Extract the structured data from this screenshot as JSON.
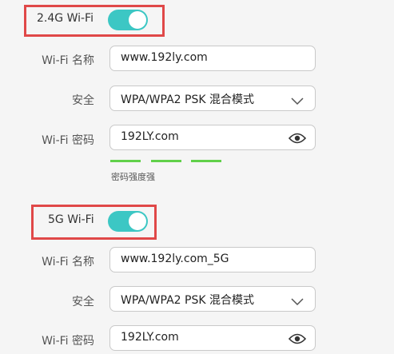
{
  "band24": {
    "label": "2.4G Wi-Fi",
    "enabled": true,
    "ssid_label": "Wi-Fi 名称",
    "ssid_value": "www.192ly.com",
    "security_label": "安全",
    "security_value": "WPA/WPA2 PSK 混合模式",
    "password_label": "Wi-Fi 密码",
    "password_value": "192LY.com",
    "strength_segments": 3,
    "strength_label": "密码强度强"
  },
  "band5": {
    "label": "5G Wi-Fi",
    "enabled": true,
    "ssid_label": "Wi-Fi 名称",
    "ssid_value": "www.192ly.com_5G",
    "security_label": "安全",
    "security_value": "WPA/WPA2 PSK 混合模式",
    "password_label": "Wi-Fi 密码",
    "password_value": "192LY.com"
  },
  "colors": {
    "toggle_on": "#3cc7c4",
    "highlight_border": "#e04848",
    "strength_strong": "#61d04a"
  },
  "icons": {
    "dropdown": "chevron-down-icon",
    "reveal_password": "eye-icon"
  }
}
